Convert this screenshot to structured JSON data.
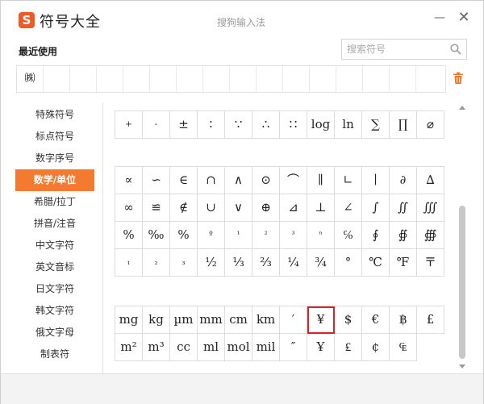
{
  "app": {
    "logo_char": "S",
    "title": "符号大全",
    "caption": "搜狗输入法",
    "minimize": "—",
    "close": "✕"
  },
  "recent": {
    "label": "最近使用",
    "items": [
      "㈱",
      "",
      "",
      "",
      "",
      "",
      "",
      "",
      "",
      "",
      "",
      "",
      "",
      "",
      "",
      ""
    ]
  },
  "search": {
    "placeholder": "搜索符号"
  },
  "sidebar": {
    "items": [
      {
        "label": "特殊符号",
        "active": false
      },
      {
        "label": "标点符号",
        "active": false
      },
      {
        "label": "数字序号",
        "active": false
      },
      {
        "label": "数学/单位",
        "active": true
      },
      {
        "label": "希腊/拉丁",
        "active": false
      },
      {
        "label": "拼音/注音",
        "active": false
      },
      {
        "label": "中文字符",
        "active": false
      },
      {
        "label": "英文音标",
        "active": false
      },
      {
        "label": "日文字符",
        "active": false
      },
      {
        "label": "韩文字符",
        "active": false
      },
      {
        "label": "俄文字母",
        "active": false
      },
      {
        "label": "制表符",
        "active": false
      }
    ]
  },
  "symbols": {
    "group1_row": [
      "+",
      "-",
      "±",
      "∶",
      "∵",
      "∴",
      "∷",
      "log",
      "ln",
      "∑",
      "∏",
      "⌀"
    ],
    "group2_rows": [
      [
        "∝",
        "∽",
        "∈",
        "∩",
        "∧",
        "⊙",
        "⌒",
        "∥",
        "∟",
        "∣",
        "∂",
        "∆"
      ],
      [
        "∞",
        "≌",
        "∉",
        "∪",
        "∨",
        "⊕",
        "⊿",
        "⊥",
        "∠",
        "∫",
        "∬",
        "∭"
      ],
      [
        "%",
        "‰",
        "%",
        "º",
        "¹",
        "²",
        "³",
        "ⁿ",
        "℅",
        "∮",
        "∯",
        "∰"
      ],
      [
        "₁",
        "₂",
        "₃",
        "½",
        "⅓",
        "⅔",
        "¼",
        "¾",
        "°",
        "℃",
        "℉",
        "〒"
      ]
    ],
    "group3_rows": [
      [
        "mg",
        "kg",
        "µm",
        "mm",
        "cm",
        "km",
        "′",
        "¥",
        "$",
        "€",
        "฿",
        "£"
      ],
      [
        "m²",
        "m³",
        "cc",
        "ml",
        "mol",
        "mil",
        "″",
        "Ұ",
        "₤",
        "¢",
        "₠"
      ]
    ],
    "selected": "¥"
  },
  "colors": {
    "accent": "#f47a30",
    "selection_border": "#e02020",
    "logo": "#f05a22"
  }
}
